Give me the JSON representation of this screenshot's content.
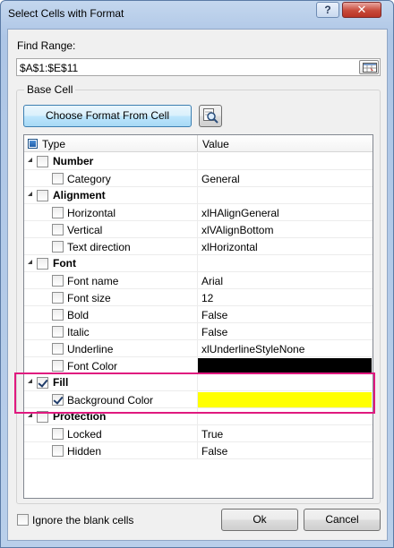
{
  "window": {
    "title": "Select Cells with Format",
    "help_label": "?",
    "close_label": "✕"
  },
  "find_range": {
    "label": "Find Range:",
    "value": "$A$1:$E$11"
  },
  "base_cell": {
    "group_label": "Base Cell",
    "choose_button_label": "Choose Format From Cell"
  },
  "tree": {
    "columns": {
      "type": "Type",
      "value": "Value"
    },
    "rows": [
      {
        "kind": "category",
        "label": "Number",
        "checked": false
      },
      {
        "kind": "item",
        "label": "Category",
        "value": "General",
        "checked": false
      },
      {
        "kind": "category",
        "label": "Alignment",
        "checked": false
      },
      {
        "kind": "item",
        "label": "Horizontal",
        "value": "xlHAlignGeneral",
        "checked": false
      },
      {
        "kind": "item",
        "label": "Vertical",
        "value": "xlVAlignBottom",
        "checked": false
      },
      {
        "kind": "item",
        "label": "Text direction",
        "value": "xlHorizontal",
        "checked": false
      },
      {
        "kind": "category",
        "label": "Font",
        "checked": false
      },
      {
        "kind": "item",
        "label": "Font name",
        "value": "Arial",
        "checked": false
      },
      {
        "kind": "item",
        "label": "Font size",
        "value": "12",
        "checked": false
      },
      {
        "kind": "item",
        "label": "Bold",
        "value": "False",
        "checked": false
      },
      {
        "kind": "item",
        "label": "Italic",
        "value": "False",
        "checked": false
      },
      {
        "kind": "item",
        "label": "Underline",
        "value": "xlUnderlineStyleNone",
        "checked": false
      },
      {
        "kind": "item",
        "label": "Font Color",
        "value": "",
        "color": "#000000",
        "checked": false
      },
      {
        "kind": "category",
        "label": "Fill",
        "checked": true
      },
      {
        "kind": "item",
        "label": "Background Color",
        "value": "",
        "color": "#ffff00",
        "checked": true
      },
      {
        "kind": "category",
        "label": "Protection",
        "checked": false
      },
      {
        "kind": "item",
        "label": "Locked",
        "value": "True",
        "checked": false
      },
      {
        "kind": "item",
        "label": "Hidden",
        "value": "False",
        "checked": false
      }
    ]
  },
  "footer": {
    "ignore_blank_label": "Ignore the blank cells",
    "ignore_blank_checked": false,
    "ok_label": "Ok",
    "cancel_label": "Cancel"
  },
  "colors": {
    "highlight_border": "#e0197f",
    "font_color_swatch": "#000000",
    "fill_swatch": "#ffff00"
  }
}
